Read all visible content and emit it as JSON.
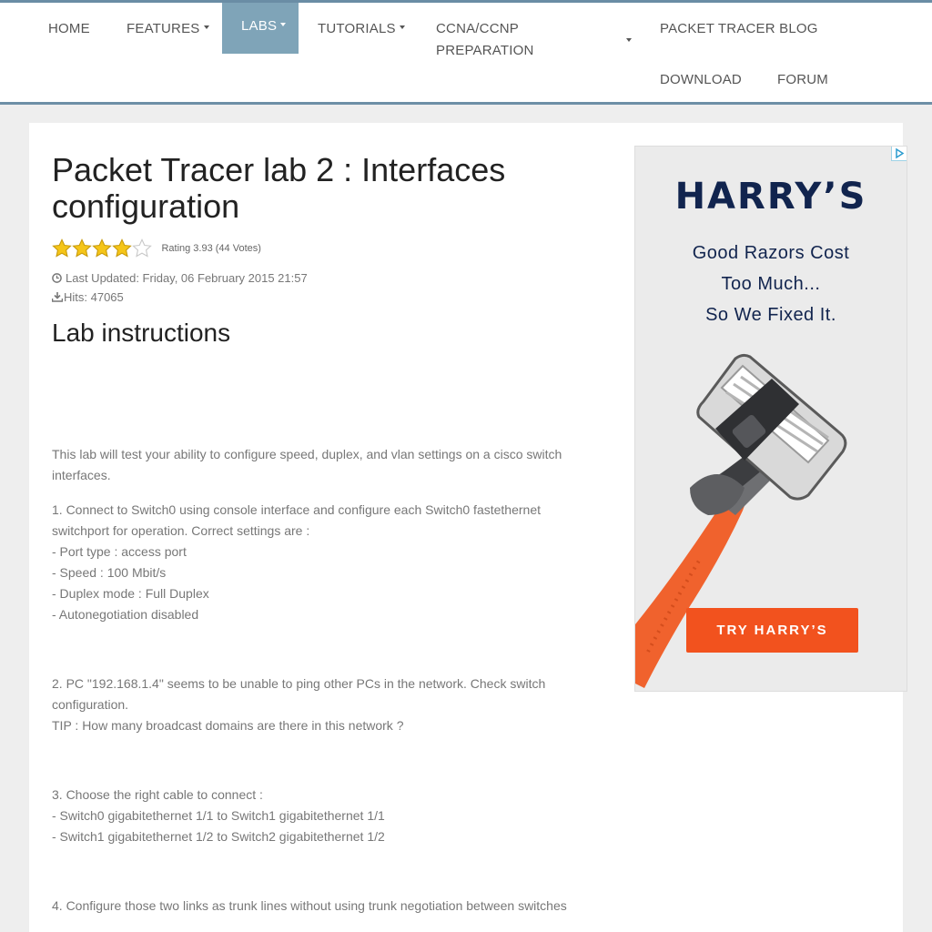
{
  "nav": {
    "home": "HOME",
    "features": "FEATURES",
    "labs": "LABS",
    "tutorials": "TUTORIALS",
    "ccna_line1": "CCNA/CCNP",
    "ccna_line2": "PREPARATION",
    "blog": "PACKET TRACER BLOG",
    "download": "DOWNLOAD",
    "forum": "FORUM"
  },
  "article": {
    "title": "Packet Tracer lab 2 : Interfaces configuration",
    "rating": {
      "text": "Rating 3.93 (44 Votes)",
      "value": 3.93,
      "max": 5
    },
    "last_updated": "Last Updated: Friday, 06 February 2015 21:57",
    "hits": "Hits: 47065",
    "section_heading": "Lab instructions",
    "intro_line1": "This lab will test your ability to configure speed, duplex, and vlan settings on a cisco switch",
    "intro_line2": "interfaces.",
    "step1": [
      "1. Connect to Switch0 using console interface and configure each Switch0 fastethernet",
      "switchport for operation. Correct settings are :",
      "- Port type : access port",
      "- Speed : 100 Mbit/s",
      "- Duplex mode : Full Duplex",
      "- Autonegotiation disabled"
    ],
    "step2": [
      "2. PC \"192.168.1.4\" seems to be unable to ping other PCs in the network. Check switch",
      "configuration.",
      "TIP : How many broadcast domains are there in this network ?"
    ],
    "step3": [
      "3. Choose the right cable to connect :",
      "- Switch0 gigabitethernet 1/1 to Switch1 gigabitethernet 1/1",
      "- Switch1 gigabitethernet 1/2 to Switch2 gigabitethernet 1/2"
    ],
    "step4": "4. Configure those two links as trunk lines without using trunk negotiation between switches"
  },
  "ad": {
    "brand": "HARRY’S",
    "tagline": [
      "Good Razors Cost",
      "Too Much...",
      "So We Fixed It."
    ],
    "cta": "TRY HARRY’S",
    "colors": {
      "brand": "#11244e",
      "cta": "#f2521e",
      "background": "#ebebeb"
    }
  },
  "colors": {
    "nav_active": "#7fa4b8",
    "nav_border": "#6d8fa6",
    "page_bg": "#eeeeee"
  }
}
